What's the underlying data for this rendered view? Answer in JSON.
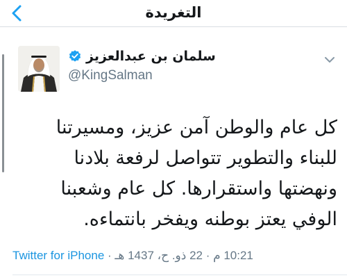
{
  "nav": {
    "title": "التغريدة",
    "back_icon": "chevron-left-icon"
  },
  "tweet": {
    "author": {
      "display_name": "سلمان بن عبدالعزيز",
      "handle": "@KingSalman",
      "verified": true,
      "verified_icon": "verified-badge-icon"
    },
    "text": "كل عام والوطن آمن عزيز، ومسيرتنا للبناء والتطوير تتواصل لرفعة بلادنا ونهضتها واستقرارها. كل عام وشعبنا الوفي يعتز بوطنه ويفخر بانتماءه.",
    "source": "Twitter for iPhone",
    "separator": "·",
    "timestamp": "10:21 م · 22 ذو. ح، 1437 هـ"
  },
  "colors": {
    "accent": "#1b95e0",
    "text": "#14171a",
    "secondary": "#657786",
    "verified": "#1da1f2"
  }
}
